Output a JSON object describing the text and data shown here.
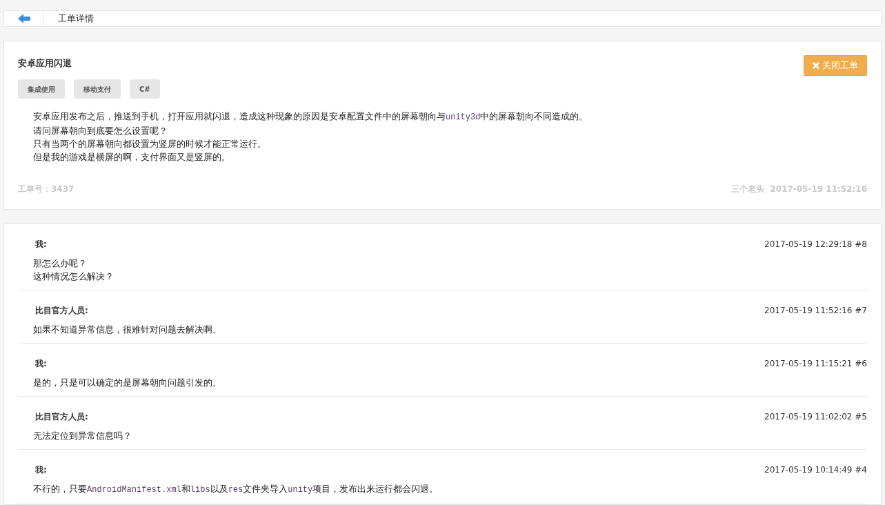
{
  "header": {
    "title": "工单详情"
  },
  "ticket": {
    "title": "安卓应用闪退",
    "close_button": "关闭工单",
    "tags": [
      "集成使用",
      "移动支付",
      "C#"
    ],
    "body": [
      [
        {
          "kind": "text",
          "text": "安卓应用发布之后，推送到手机，打开应用就闪退，造成这种现象的原因是安卓配置文件中的屏幕朝向与"
        },
        {
          "kind": "code",
          "text": "unity3d"
        },
        {
          "kind": "text",
          "text": "中的屏幕朝向不同造成的。"
        }
      ],
      [
        {
          "kind": "text",
          "text": "请问屏幕朝向到底要怎么设置呢？"
        }
      ],
      [
        {
          "kind": "text",
          "text": "只有当两个的屏幕朝向都设置为竖屏的时候才能正常运行。"
        }
      ],
      [
        {
          "kind": "text",
          "text": "但是我的游戏是横屏的啊，支付界面又是竖屏的。"
        }
      ]
    ],
    "number": "工单号：3437",
    "author": "三个老头",
    "time": "2017-05-19 11:52:16"
  },
  "replies": [
    {
      "author": "我:",
      "meta": "2017-05-19 12:29:18 #8",
      "lines": [
        [
          {
            "kind": "text",
            "text": "那怎么办呢？"
          }
        ],
        [
          {
            "kind": "text",
            "text": "这种情况怎么解决？"
          }
        ]
      ]
    },
    {
      "author": "比目官方人员:",
      "meta": "2017-05-19 11:52:16 #7",
      "lines": [
        [
          {
            "kind": "text",
            "text": "如果不知道异常信息，很难针对问题去解决啊。"
          }
        ]
      ]
    },
    {
      "author": "我:",
      "meta": "2017-05-19 11:15:21 #6",
      "lines": [
        [
          {
            "kind": "text",
            "text": "是的，只是可以确定的是屏幕朝向问题引发的。"
          }
        ]
      ]
    },
    {
      "author": "比目官方人员:",
      "meta": "2017-05-19 11:02:02 #5",
      "lines": [
        [
          {
            "kind": "text",
            "text": "无法定位到异常信息吗？"
          }
        ]
      ]
    },
    {
      "author": "我:",
      "meta": "2017-05-19 10:14:49 #4",
      "lines": [
        [
          {
            "kind": "text",
            "text": "不行的，只要"
          },
          {
            "kind": "code",
            "text": "AndroidManifest.xml"
          },
          {
            "kind": "text",
            "text": "和"
          },
          {
            "kind": "code",
            "text": "libs"
          },
          {
            "kind": "text",
            "text": "以及"
          },
          {
            "kind": "code",
            "text": "res"
          },
          {
            "kind": "text",
            "text": "文件夹导入"
          },
          {
            "kind": "code",
            "text": "unity"
          },
          {
            "kind": "text",
            "text": "项目，发布出来运行都会闪退。"
          }
        ]
      ]
    }
  ]
}
